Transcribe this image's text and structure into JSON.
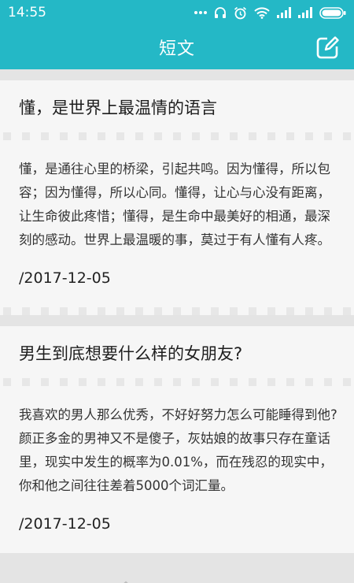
{
  "status_bar": {
    "time": "14:55"
  },
  "app_bar": {
    "title": "短文",
    "action_icon": "edit-icon"
  },
  "colors": {
    "primary": "#24b8c6",
    "card_background": "#f6f6f6",
    "page_background": "#e4e4e4"
  },
  "articles": [
    {
      "title": "懂，是世界上最温情的语言",
      "body": "懂，是通往心里的桥梁，引起共鸣。因为懂得，所以包容；因为懂得，所以心同。懂得，让心与心没有距离，让生命彼此疼惜；懂得，是生命中最美好的相通，最深刻的感动。世界上最温暖的事，莫过于有人懂有人疼。",
      "date": "/2017-12-05"
    },
    {
      "title": "男生到底想要什么样的女朋友?",
      "body": "我喜欢的男人那么优秀，不好好努力怎么可能睡得到他? 颜正多金的男神又不是傻子，灰姑娘的故事只存在童话里，现实中发生的概率为0.01%，而在残忍的现实中，你和他之间往往差着5000个词汇量。",
      "date": "/2017-12-05"
    }
  ]
}
